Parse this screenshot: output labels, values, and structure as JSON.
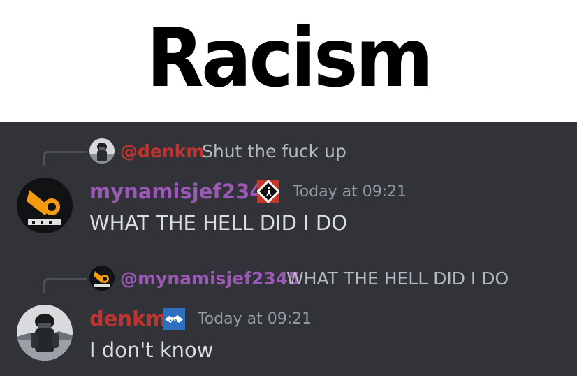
{
  "caption": {
    "title": "Racism"
  },
  "colors": {
    "background": "#313338",
    "name_red": "#c0342f",
    "name_purple": "#9b59b6",
    "text": "#dbdee1",
    "muted": "#949ba4"
  },
  "messages": [
    {
      "reply_mention": "@denkm",
      "reply_text": "Shut the fuck up",
      "reply_avatar_icon": "soldier-avatar-icon",
      "username": "mynamisjef2345",
      "role_icon": "no-pedestrian-sign-icon",
      "timestamp": "Today at 09:21",
      "content": "WHAT THE HELL DID I DO",
      "avatar_icon": "half-life-logo-avatar-icon"
    },
    {
      "reply_mention": "@mynamisjef2345",
      "reply_text": "WHAT THE HELL DID I DO",
      "reply_avatar_icon": "half-life-logo-avatar-icon",
      "username": "denkm",
      "role_icon": "handshake-icon",
      "timestamp": "Today at 09:21",
      "content": "I don't know",
      "avatar_icon": "soldier-avatar-icon"
    }
  ]
}
